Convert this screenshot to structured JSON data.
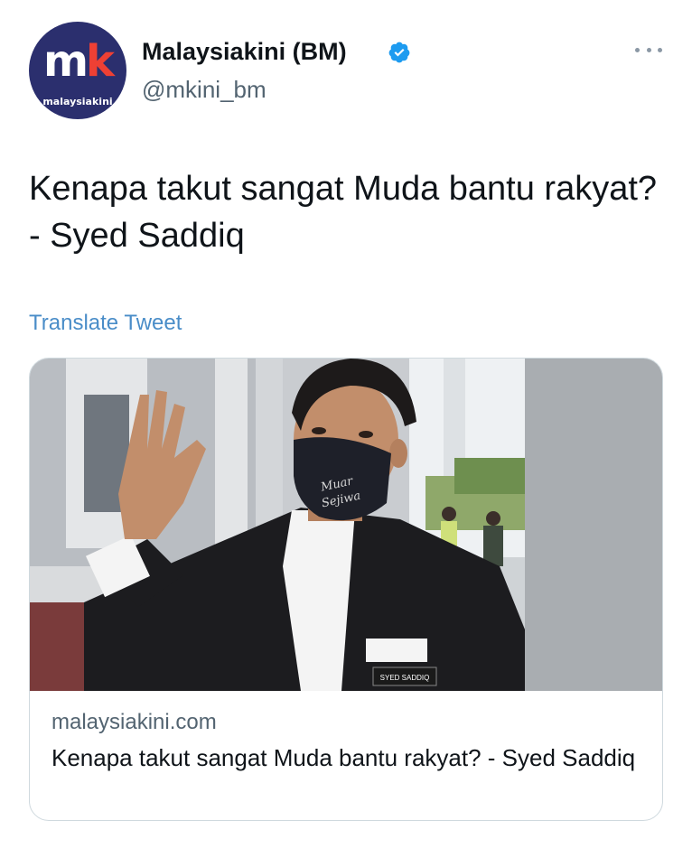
{
  "account": {
    "avatar_logo": "mk",
    "avatar_sub": "malaysiakini",
    "display_name": "Malaysiakini (BM)",
    "handle": "@mkini_bm",
    "verified_icon": "verified-badge-icon",
    "more_icon": "more-options-icon"
  },
  "tweet": {
    "text": "Kenapa takut sangat Muda bantu rakyat? - Syed Saddiq",
    "translate_label": "Translate Tweet"
  },
  "card": {
    "mask_text_line1": "Muar",
    "mask_text_line2": "Sejiwa",
    "name_tag": "SYED SADDIQ",
    "domain": "malaysiakini.com",
    "title": "Kenapa takut sangat Muda bantu rakyat? - Syed Saddiq"
  },
  "colors": {
    "avatar_bg": "#2b2f6e",
    "avatar_accent": "#ee4034",
    "verified": "#1d9bf0",
    "link": "#4a8dc8",
    "secondary_text": "#536471"
  }
}
